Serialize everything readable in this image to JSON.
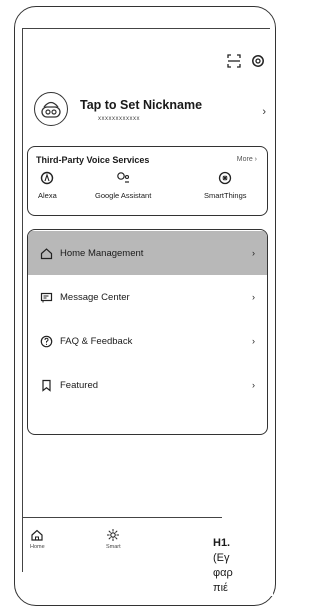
{
  "header": {
    "icons": [
      "scan-icon",
      "settings-icon"
    ]
  },
  "profile": {
    "nickname": "Tap to Set Nickname",
    "user_id": "xxxxxxxxxxxx",
    "chevron": "›"
  },
  "voice_services": {
    "title": "Third-Party Voice Services",
    "more": "More ›",
    "services": [
      {
        "label": "Alexa",
        "icon": "alexa-icon"
      },
      {
        "label": "Google Assistant",
        "icon": "google-assistant-icon"
      },
      {
        "label": "SmartThings",
        "icon": "smartthings-icon"
      }
    ]
  },
  "menu": {
    "chevron": "›",
    "items": [
      {
        "label": "Home Management",
        "icon": "home-icon",
        "active": true
      },
      {
        "label": "Message Center",
        "icon": "message-icon",
        "active": false
      },
      {
        "label": "FAQ & Feedback",
        "icon": "question-icon",
        "active": false
      },
      {
        "label": "Featured",
        "icon": "bookmark-icon",
        "active": false
      }
    ]
  },
  "tabbar": {
    "tabs": [
      {
        "label": "Home",
        "icon": "home-tab-icon"
      },
      {
        "label": "Smart",
        "icon": "smart-tab-icon"
      }
    ]
  },
  "caption": {
    "line1": "H1.",
    "line2": "(Εγ",
    "line3": "φαρ",
    "line4": "πιέ"
  }
}
